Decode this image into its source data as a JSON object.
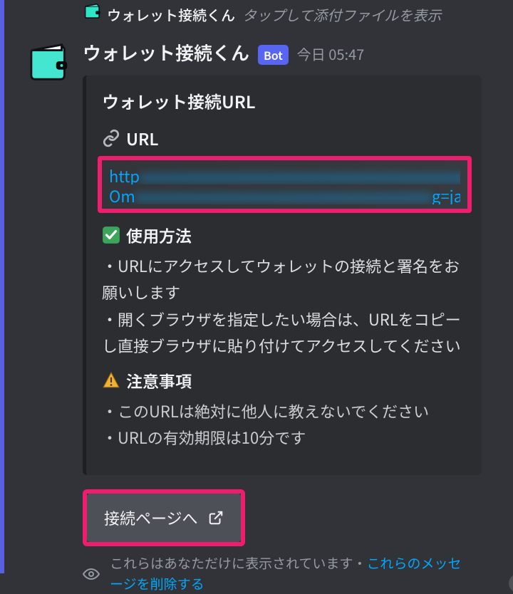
{
  "top": {
    "name": "ウォレット接続くん",
    "sub": "タップして添付ファイルを表示"
  },
  "message": {
    "username": "ウォレット接続くん",
    "bot_tag": "Bot",
    "timestamp": "今日 05:47"
  },
  "embed": {
    "title": "ウォレット接続URL",
    "url_label": "URL",
    "url_line1_start": "http",
    "url_line2_end": "g=ja",
    "howto_label": "使用方法",
    "howto_body": "・URLにアクセスしてウォレットの接続と署名をお願いします\n・開くブラウザを指定したい場合は、URLをコピーし直接ブラウザに貼り付けてアクセスしてください",
    "caution_label": "注意事項",
    "caution_body": "・このURLは絶対に他人に教えないでください\n・URLの有効期限は10分です"
  },
  "button": {
    "label": "接続ページへ"
  },
  "footer": {
    "text_prefix": "これらはあなただけに表示されています・",
    "link": "これらのメッセージを削除する"
  }
}
